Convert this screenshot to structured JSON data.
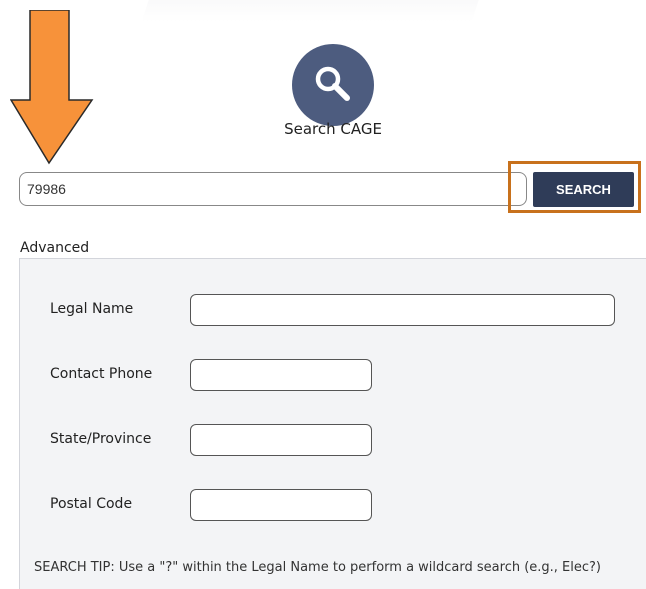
{
  "header": {
    "title": "Search CAGE",
    "icon": "search-icon",
    "icon_bg_color": "#4d5c7f"
  },
  "search": {
    "value": "79986",
    "button_label": "SEARCH",
    "button_color": "#2f3c58"
  },
  "annotations": {
    "arrow_color": "#f7923a",
    "highlight_color": "#c8711c"
  },
  "advanced": {
    "label": "Advanced",
    "fields": [
      {
        "label": "Legal Name",
        "value": ""
      },
      {
        "label": "Contact Phone",
        "value": ""
      },
      {
        "label": "State/Province",
        "value": ""
      },
      {
        "label": "Postal Code",
        "value": ""
      }
    ],
    "tip": "SEARCH TIP: Use a \"?\" within the Legal Name to perform a wildcard search (e.g., Elec?)"
  }
}
